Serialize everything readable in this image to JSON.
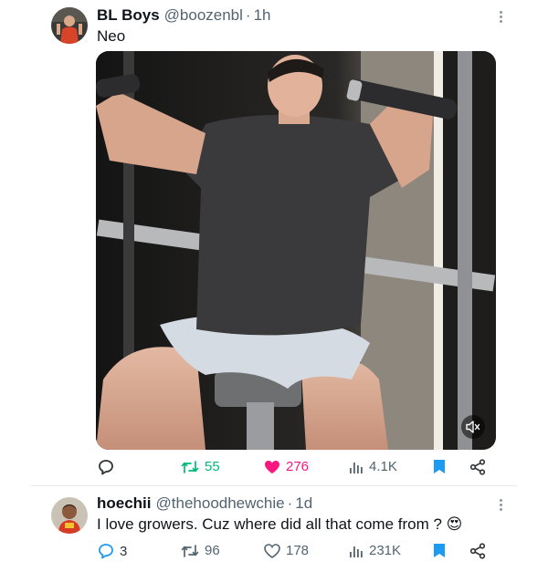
{
  "tweet1": {
    "name": "BL Boys",
    "handle": "@boozenbl",
    "separator": "·",
    "time": "1h",
    "text": "Neo",
    "video": {
      "muted": true
    },
    "stats": {
      "reply": "",
      "retweets": "55",
      "likes": "276",
      "views": "4.1K"
    },
    "liked": true
  },
  "tweet2": {
    "name": "hoechii",
    "handle": "@thehoodhewchie",
    "separator": "·",
    "time": "1d",
    "text": "I love growers. Cuz where did all that come from ?",
    "emoji": "😍",
    "stats": {
      "replies": "3",
      "retweets": "96",
      "likes": "178",
      "views": "231K"
    }
  },
  "colors": {
    "text": "#0f1419",
    "secondary": "#536471",
    "like": "#f91880",
    "retweet": "#00ba7c",
    "accent": "#1d9bf0"
  },
  "icons": [
    "reply-icon",
    "retweet-icon",
    "like-icon",
    "views-icon",
    "bookmark-icon",
    "share-icon",
    "mute-icon",
    "more-icon"
  ]
}
